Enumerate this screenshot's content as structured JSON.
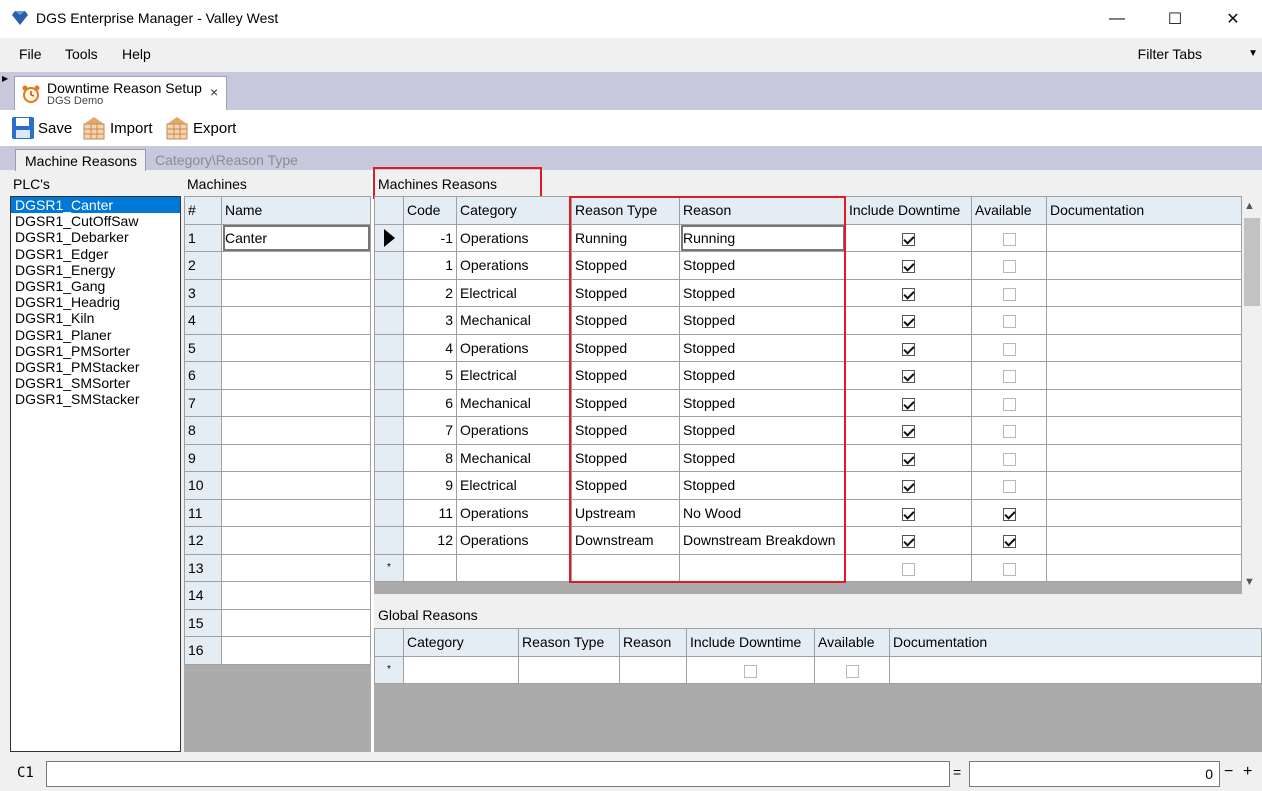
{
  "window": {
    "title": "DGS Enterprise Manager - Valley West",
    "minimize": "—",
    "maximize": "☐",
    "close": "✕"
  },
  "menu": {
    "items": [
      "File",
      "Tools",
      "Help"
    ],
    "filter_tabs": "Filter Tabs"
  },
  "doc_tab": {
    "title": "Downtime Reason Setup",
    "subtitle": "DGS Demo",
    "close": "×"
  },
  "toolbar": {
    "save": "Save",
    "import": "Import",
    "export": "Export"
  },
  "inner_tabs": [
    "Machine Reasons",
    "Category\\Reason Type"
  ],
  "plcs": {
    "label": "PLC's",
    "items": [
      "DGSR1_Canter",
      "DGSR1_CutOffSaw",
      "DGSR1_Debarker",
      "DGSR1_Edger",
      "DGSR1_Energy",
      "DGSR1_Gang",
      "DGSR1_Headrig",
      "DGSR1_Kiln",
      "DGSR1_Planer",
      "DGSR1_PMSorter",
      "DGSR1_PMStacker",
      "DGSR1_SMSorter",
      "DGSR1_SMStacker"
    ],
    "selected": "DGSR1_Canter"
  },
  "machines": {
    "label": "Machines",
    "headers": [
      "#",
      "Name"
    ],
    "rows": [
      {
        "num": "1",
        "name": "Canter"
      },
      {
        "num": "2",
        "name": ""
      },
      {
        "num": "3",
        "name": ""
      },
      {
        "num": "4",
        "name": ""
      },
      {
        "num": "5",
        "name": ""
      },
      {
        "num": "6",
        "name": ""
      },
      {
        "num": "7",
        "name": ""
      },
      {
        "num": "8",
        "name": ""
      },
      {
        "num": "9",
        "name": ""
      },
      {
        "num": "10",
        "name": ""
      },
      {
        "num": "11",
        "name": ""
      },
      {
        "num": "12",
        "name": ""
      },
      {
        "num": "13",
        "name": ""
      },
      {
        "num": "14",
        "name": ""
      },
      {
        "num": "15",
        "name": ""
      },
      {
        "num": "16",
        "name": ""
      }
    ]
  },
  "machine_reasons": {
    "label": "Machines Reasons",
    "headers": [
      "Code",
      "Category",
      "Reason Type",
      "Reason",
      "Include Downtime",
      "Available",
      "Documentation"
    ],
    "rows": [
      {
        "code": "-1",
        "category": "Operations",
        "reason_type": "Running",
        "reason": "Running",
        "include_downtime": true,
        "available": false,
        "documentation": ""
      },
      {
        "code": "1",
        "category": "Operations",
        "reason_type": "Stopped",
        "reason": "Stopped",
        "include_downtime": true,
        "available": false,
        "documentation": ""
      },
      {
        "code": "2",
        "category": "Electrical",
        "reason_type": "Stopped",
        "reason": "Stopped",
        "include_downtime": true,
        "available": false,
        "documentation": ""
      },
      {
        "code": "3",
        "category": "Mechanical",
        "reason_type": "Stopped",
        "reason": "Stopped",
        "include_downtime": true,
        "available": false,
        "documentation": ""
      },
      {
        "code": "4",
        "category": "Operations",
        "reason_type": "Stopped",
        "reason": "Stopped",
        "include_downtime": true,
        "available": false,
        "documentation": ""
      },
      {
        "code": "5",
        "category": "Electrical",
        "reason_type": "Stopped",
        "reason": "Stopped",
        "include_downtime": true,
        "available": false,
        "documentation": ""
      },
      {
        "code": "6",
        "category": "Mechanical",
        "reason_type": "Stopped",
        "reason": "Stopped",
        "include_downtime": true,
        "available": false,
        "documentation": ""
      },
      {
        "code": "7",
        "category": "Operations",
        "reason_type": "Stopped",
        "reason": "Stopped",
        "include_downtime": true,
        "available": false,
        "documentation": ""
      },
      {
        "code": "8",
        "category": "Mechanical",
        "reason_type": "Stopped",
        "reason": "Stopped",
        "include_downtime": true,
        "available": false,
        "documentation": ""
      },
      {
        "code": "9",
        "category": "Electrical",
        "reason_type": "Stopped",
        "reason": "Stopped",
        "include_downtime": true,
        "available": false,
        "documentation": ""
      },
      {
        "code": "11",
        "category": "Operations",
        "reason_type": "Upstream",
        "reason": "No Wood",
        "include_downtime": true,
        "available": true,
        "documentation": ""
      },
      {
        "code": "12",
        "category": "Operations",
        "reason_type": "Downstream",
        "reason": "Downstream Breakdown",
        "include_downtime": true,
        "available": true,
        "documentation": ""
      }
    ],
    "new_row_marker": "*"
  },
  "global_reasons": {
    "label": "Global Reasons",
    "headers": [
      "Category",
      "Reason Type",
      "Reason",
      "Include Downtime",
      "Available",
      "Documentation"
    ],
    "new_row_marker": "*"
  },
  "statusbar": {
    "cell_ref": "C1",
    "formula": "",
    "equals": "=",
    "value": "0",
    "minus": "−",
    "plus": "+"
  },
  "colors": {
    "selection": "#0078d7",
    "highlight_box": "#e01b24",
    "tab_strip": "#c8c8dc",
    "grid_header": "#e4ecf4"
  }
}
